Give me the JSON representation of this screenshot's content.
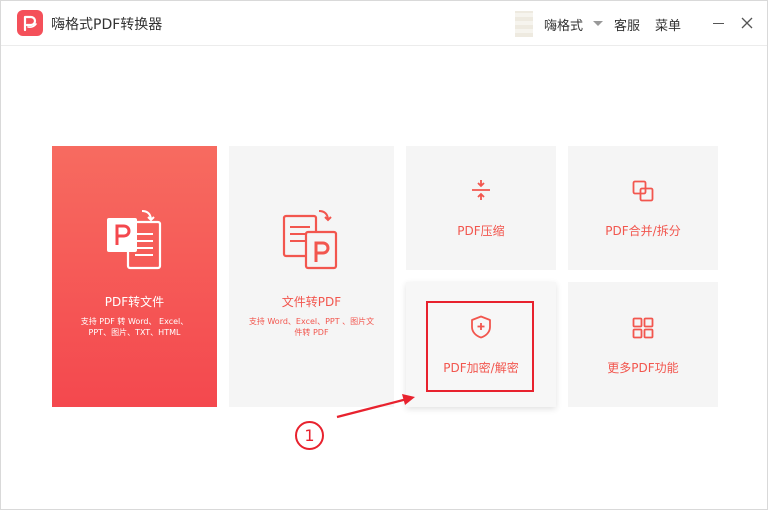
{
  "app": {
    "title": "嗨格式PDF转换器",
    "username": "嗨格式",
    "service_label": "客服",
    "menu_label": "菜单"
  },
  "tiles": {
    "pdf_to_word": {
      "label": "PDF转文件",
      "desc_line1": "支持 PDF 转 Word、 Excel、",
      "desc_line2": "PPT、图片、TXT、HTML"
    },
    "word_to_pdf": {
      "label": "文件转PDF",
      "desc_line1": "支持 Word、Excel、PPT 、图片文",
      "desc_line2": "件转 PDF"
    },
    "compress": {
      "label": "PDF压缩"
    },
    "merge_split": {
      "label": "PDF合并/拆分"
    },
    "encrypt": {
      "label": "PDF加密/解密"
    },
    "more": {
      "label": "更多PDF功能"
    }
  },
  "annotation": {
    "step_marker": "①"
  },
  "colors": {
    "accent": "#f4505a",
    "tile_bg": "#f5f5f5",
    "highlight": "#e8222e"
  },
  "icons": [
    "app-logo-icon",
    "pdf-to-file-icon",
    "file-to-pdf-icon",
    "compress-icon",
    "merge-split-icon",
    "shield-lock-icon",
    "grid-more-icon",
    "minimize-icon",
    "close-icon"
  ]
}
